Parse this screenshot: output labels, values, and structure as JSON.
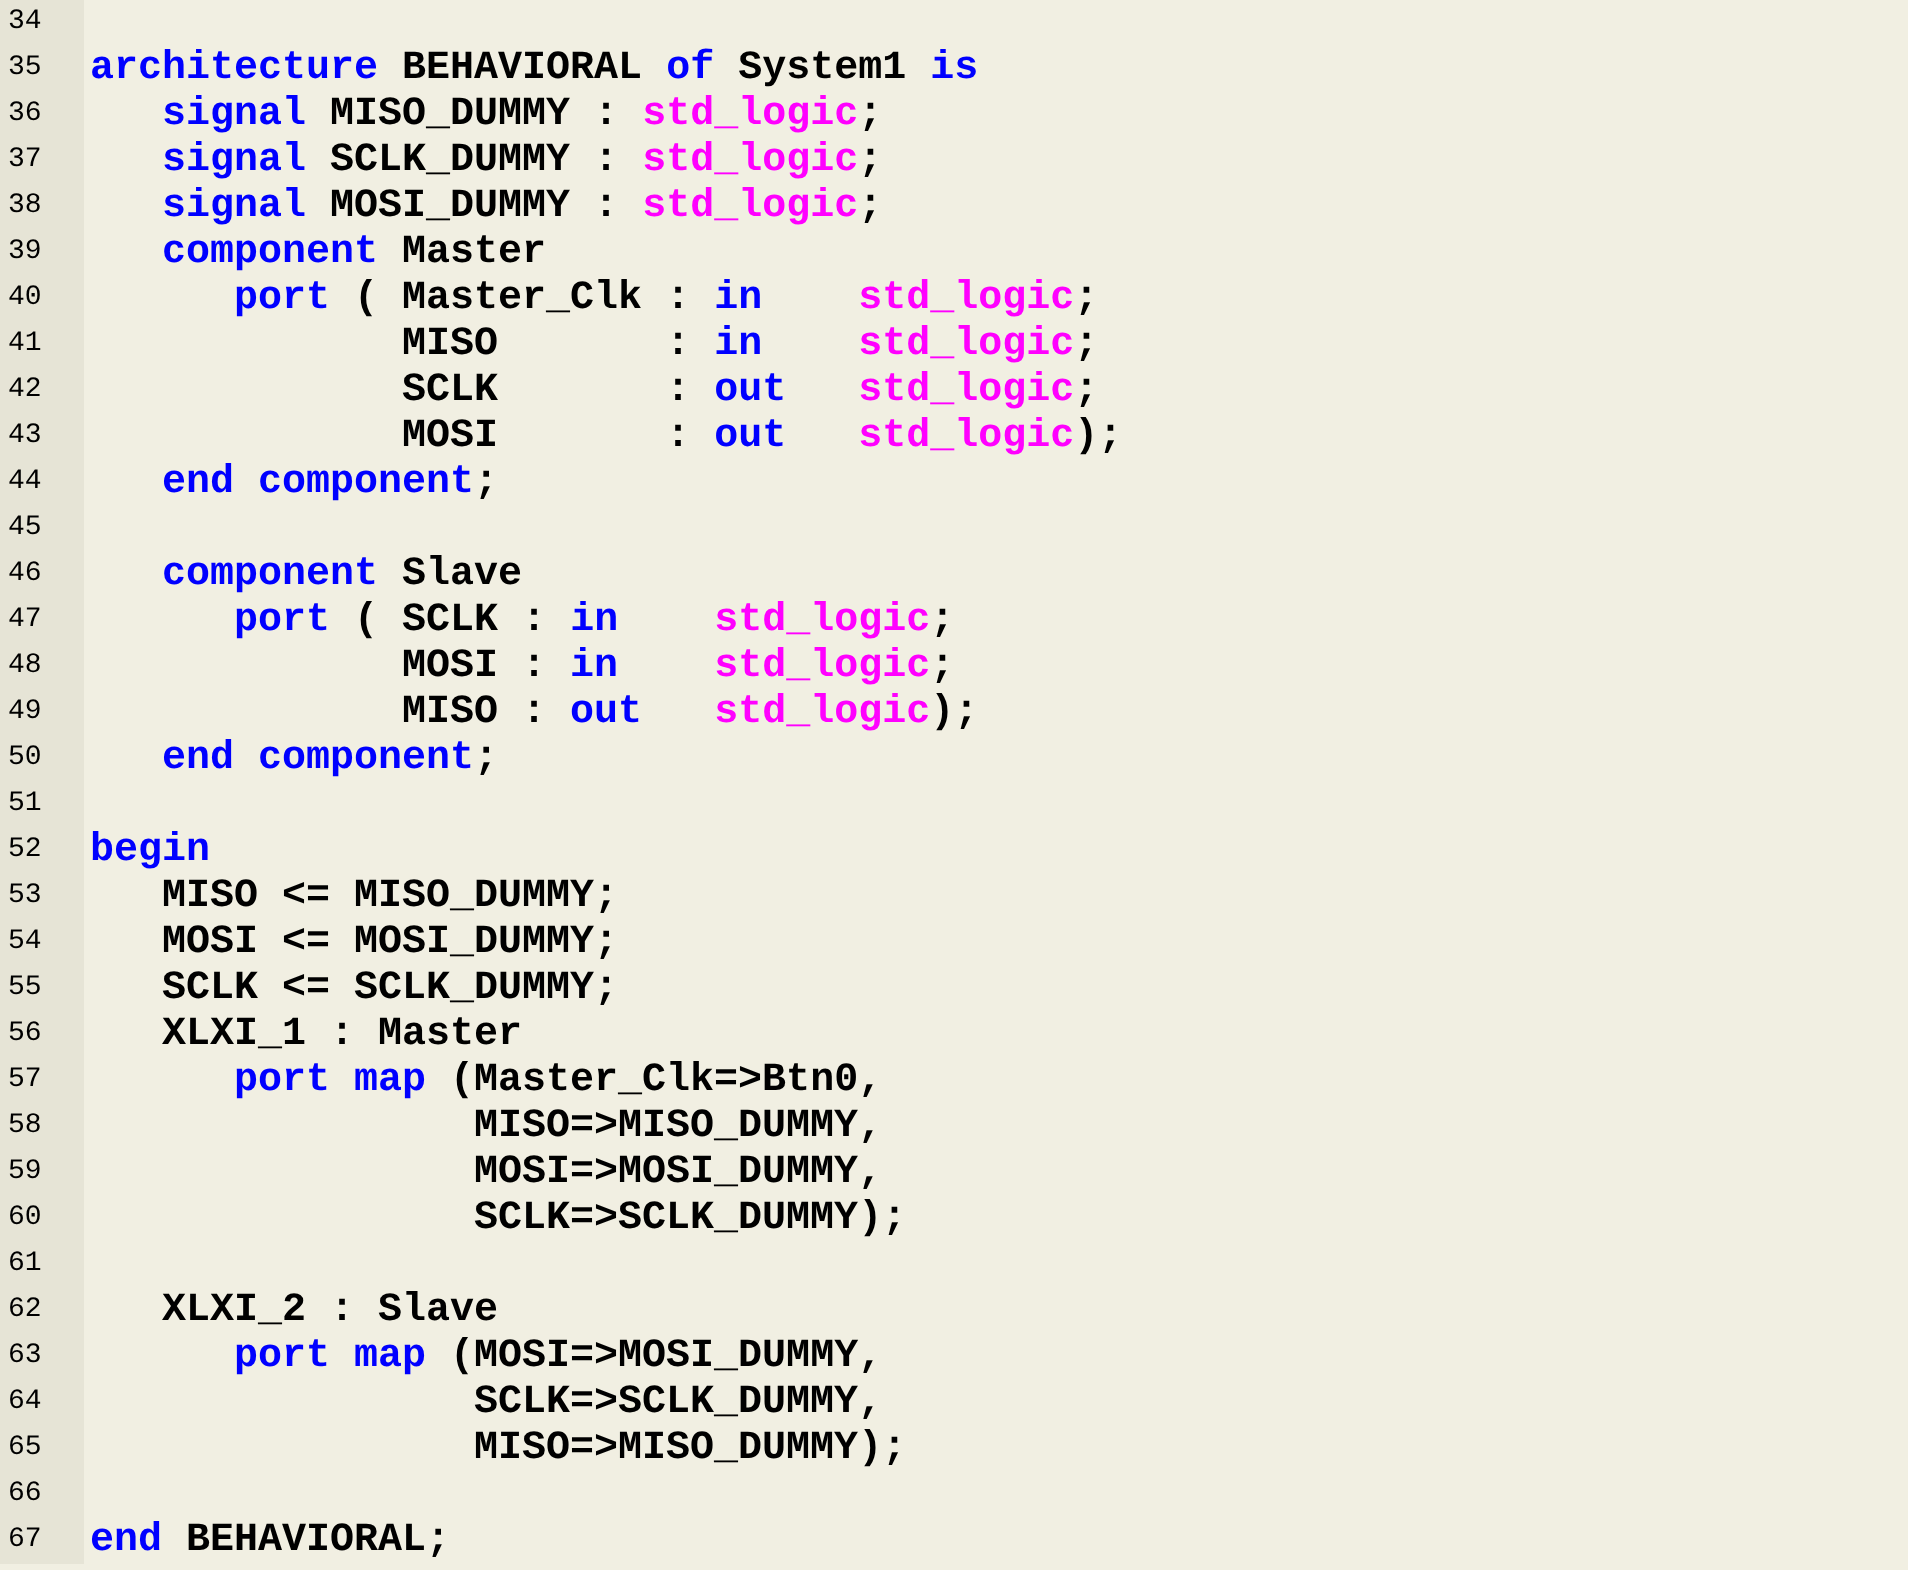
{
  "editor": {
    "lines": [
      {
        "number": "34"
      },
      {
        "number": "35",
        "tokens": [
          {
            "kind": "keyword",
            "text": "architecture"
          },
          {
            "kind": "plain",
            "text": " BEHAVIORAL "
          },
          {
            "kind": "keyword",
            "text": "of"
          },
          {
            "kind": "plain",
            "text": " System1 "
          },
          {
            "kind": "keyword",
            "text": "is"
          }
        ]
      },
      {
        "number": "36",
        "tokens": [
          {
            "kind": "keyword",
            "text": "   signal"
          },
          {
            "kind": "plain",
            "text": " MISO_DUMMY : "
          },
          {
            "kind": "type",
            "text": "std_logic"
          },
          {
            "kind": "plain",
            "text": ";"
          }
        ]
      },
      {
        "number": "37",
        "tokens": [
          {
            "kind": "keyword",
            "text": "   signal"
          },
          {
            "kind": "plain",
            "text": " SCLK_DUMMY : "
          },
          {
            "kind": "type",
            "text": "std_logic"
          },
          {
            "kind": "plain",
            "text": ";"
          }
        ]
      },
      {
        "number": "38",
        "tokens": [
          {
            "kind": "keyword",
            "text": "   signal"
          },
          {
            "kind": "plain",
            "text": " MOSI_DUMMY : "
          },
          {
            "kind": "type",
            "text": "std_logic"
          },
          {
            "kind": "plain",
            "text": ";"
          }
        ]
      },
      {
        "number": "39",
        "tokens": [
          {
            "kind": "keyword",
            "text": "   component"
          },
          {
            "kind": "plain",
            "text": " Master"
          }
        ]
      },
      {
        "number": "40",
        "tokens": [
          {
            "kind": "keyword",
            "text": "      port"
          },
          {
            "kind": "plain",
            "text": " ( Master_Clk : "
          },
          {
            "kind": "keyword",
            "text": "in"
          },
          {
            "kind": "type",
            "text": "    std_logic"
          },
          {
            "kind": "plain",
            "text": ";"
          }
        ]
      },
      {
        "number": "41",
        "tokens": [
          {
            "kind": "plain",
            "text": "             MISO       : "
          },
          {
            "kind": "keyword",
            "text": "in"
          },
          {
            "kind": "type",
            "text": "    std_logic"
          },
          {
            "kind": "plain",
            "text": ";"
          }
        ]
      },
      {
        "number": "42",
        "tokens": [
          {
            "kind": "plain",
            "text": "             SCLK       : "
          },
          {
            "kind": "keyword",
            "text": "out"
          },
          {
            "kind": "type",
            "text": "   std_logic"
          },
          {
            "kind": "plain",
            "text": ";"
          }
        ]
      },
      {
        "number": "43",
        "tokens": [
          {
            "kind": "plain",
            "text": "             MOSI       : "
          },
          {
            "kind": "keyword",
            "text": "out"
          },
          {
            "kind": "type",
            "text": "   std_logic"
          },
          {
            "kind": "plain",
            "text": ");"
          }
        ]
      },
      {
        "number": "44",
        "tokens": [
          {
            "kind": "keyword",
            "text": "   end component"
          },
          {
            "kind": "plain",
            "text": ";"
          }
        ]
      },
      {
        "number": "45"
      },
      {
        "number": "46",
        "tokens": [
          {
            "kind": "keyword",
            "text": "   component"
          },
          {
            "kind": "plain",
            "text": " Slave"
          }
        ]
      },
      {
        "number": "47",
        "tokens": [
          {
            "kind": "keyword",
            "text": "      port"
          },
          {
            "kind": "plain",
            "text": " ( SCLK : "
          },
          {
            "kind": "keyword",
            "text": "in"
          },
          {
            "kind": "type",
            "text": "    std_logic"
          },
          {
            "kind": "plain",
            "text": ";"
          }
        ]
      },
      {
        "number": "48",
        "tokens": [
          {
            "kind": "plain",
            "text": "             MOSI : "
          },
          {
            "kind": "keyword",
            "text": "in"
          },
          {
            "kind": "type",
            "text": "    std_logic"
          },
          {
            "kind": "plain",
            "text": ";"
          }
        ]
      },
      {
        "number": "49",
        "tokens": [
          {
            "kind": "plain",
            "text": "             MISO : "
          },
          {
            "kind": "keyword",
            "text": "out"
          },
          {
            "kind": "type",
            "text": "   std_logic"
          },
          {
            "kind": "plain",
            "text": ");"
          }
        ]
      },
      {
        "number": "50",
        "tokens": [
          {
            "kind": "keyword",
            "text": "   end component"
          },
          {
            "kind": "plain",
            "text": ";"
          }
        ]
      },
      {
        "number": "51"
      },
      {
        "number": "52",
        "tokens": [
          {
            "kind": "keyword",
            "text": "begin"
          }
        ]
      },
      {
        "number": "53",
        "tokens": [
          {
            "kind": "plain",
            "text": "   MISO <= MISO_DUMMY;"
          }
        ]
      },
      {
        "number": "54",
        "tokens": [
          {
            "kind": "plain",
            "text": "   MOSI <= MOSI_DUMMY;"
          }
        ]
      },
      {
        "number": "55",
        "tokens": [
          {
            "kind": "plain",
            "text": "   SCLK <= SCLK_DUMMY;"
          }
        ]
      },
      {
        "number": "56",
        "tokens": [
          {
            "kind": "plain",
            "text": "   XLXI_1 : Master"
          }
        ]
      },
      {
        "number": "57",
        "tokens": [
          {
            "kind": "keyword",
            "text": "      port map"
          },
          {
            "kind": "plain",
            "text": " (Master_Clk=>Btn0,"
          }
        ]
      },
      {
        "number": "58",
        "tokens": [
          {
            "kind": "plain",
            "text": "                MISO=>MISO_DUMMY,"
          }
        ]
      },
      {
        "number": "59",
        "tokens": [
          {
            "kind": "plain",
            "text": "                MOSI=>MOSI_DUMMY,"
          }
        ]
      },
      {
        "number": "60",
        "tokens": [
          {
            "kind": "plain",
            "text": "                SCLK=>SCLK_DUMMY);"
          }
        ]
      },
      {
        "number": "61"
      },
      {
        "number": "62",
        "tokens": [
          {
            "kind": "plain",
            "text": "   XLXI_2 : Slave"
          }
        ]
      },
      {
        "number": "63",
        "tokens": [
          {
            "kind": "keyword",
            "text": "      port map"
          },
          {
            "kind": "plain",
            "text": " (MOSI=>MOSI_DUMMY,"
          }
        ]
      },
      {
        "number": "64",
        "tokens": [
          {
            "kind": "plain",
            "text": "                SCLK=>SCLK_DUMMY,"
          }
        ]
      },
      {
        "number": "65",
        "tokens": [
          {
            "kind": "plain",
            "text": "                MISO=>MISO_DUMMY);"
          }
        ]
      },
      {
        "number": "66"
      },
      {
        "number": "67",
        "tokens": [
          {
            "kind": "keyword",
            "text": "end"
          },
          {
            "kind": "plain",
            "text": " BEHAVIORAL;"
          }
        ]
      }
    ]
  }
}
